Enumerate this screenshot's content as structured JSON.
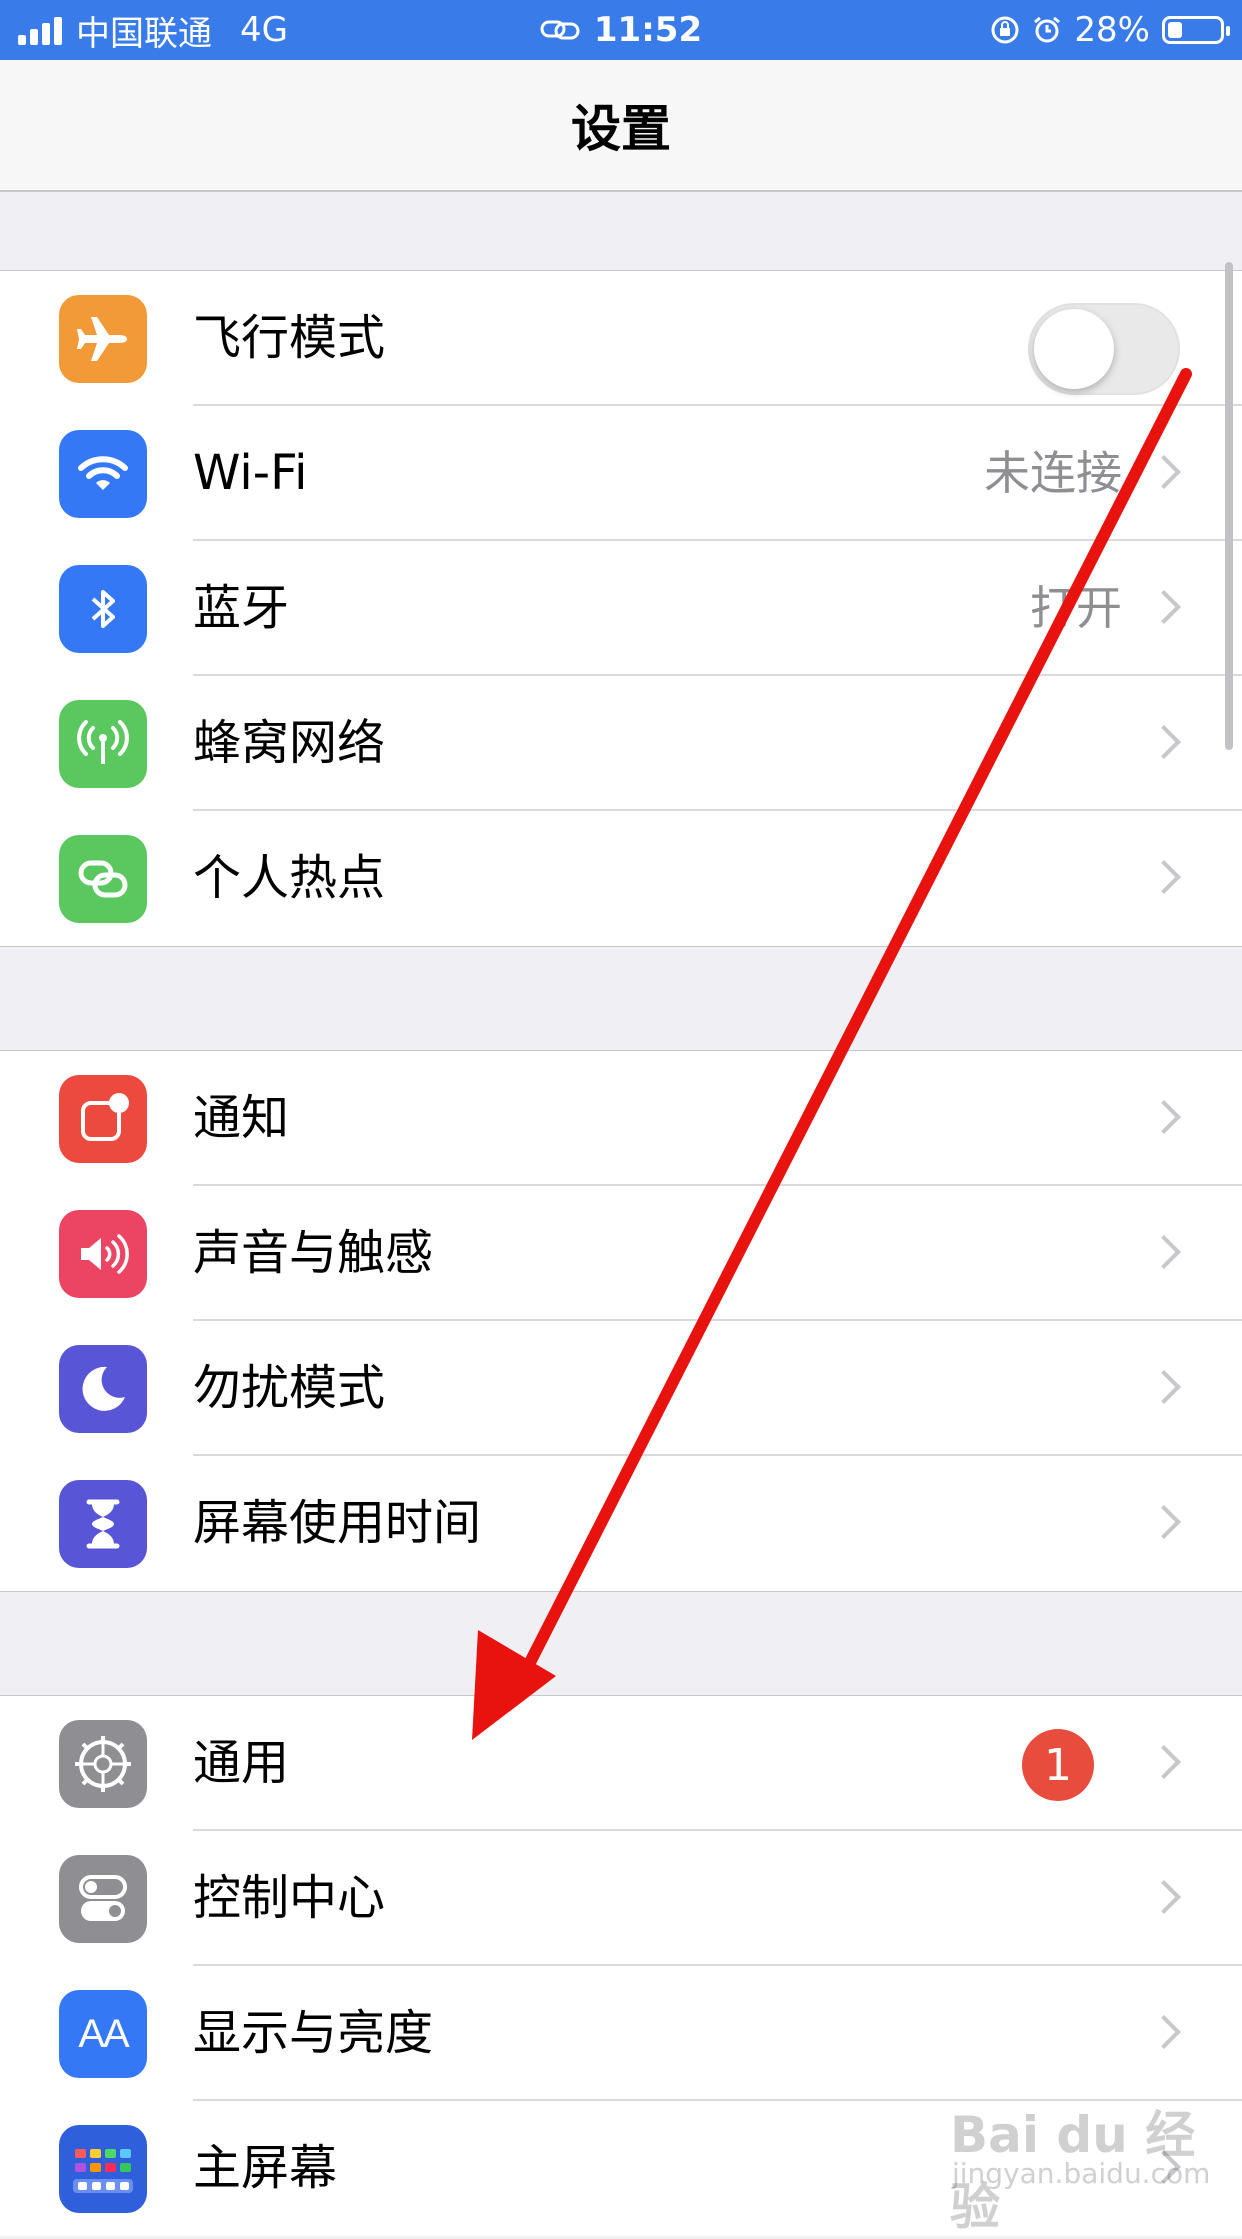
{
  "status_bar": {
    "carrier": "中国联通",
    "network": "4G",
    "time": "11:52",
    "battery": "28%",
    "battery_level": 0.28
  },
  "navbar": {
    "title": "设置"
  },
  "groups": [
    {
      "rows": [
        {
          "label": "飞行模式",
          "icon": "airplane-icon",
          "icon_color": "#f19a37",
          "control": "toggle",
          "toggle_on": false
        },
        {
          "label": "Wi-Fi",
          "icon": "wifi-icon",
          "icon_color": "#3478f6",
          "value": "未连接"
        },
        {
          "label": "蓝牙",
          "icon": "bluetooth-icon",
          "icon_color": "#3478f6",
          "value": "打开"
        },
        {
          "label": "蜂窝网络",
          "icon": "cellular-icon",
          "icon_color": "#5ac85f"
        },
        {
          "label": "个人热点",
          "icon": "hotspot-icon",
          "icon_color": "#5ac85f"
        }
      ]
    },
    {
      "rows": [
        {
          "label": "通知",
          "icon": "notifications-icon",
          "icon_color": "#ec4a3f"
        },
        {
          "label": "声音与触感",
          "icon": "speaker-icon",
          "icon_color": "#ec4563"
        },
        {
          "label": "勿扰模式",
          "icon": "moon-icon",
          "icon_color": "#5856d6"
        },
        {
          "label": "屏幕使用时间",
          "icon": "hourglass-icon",
          "icon_color": "#5856d6"
        }
      ]
    },
    {
      "rows": [
        {
          "label": "通用",
          "icon": "gear-icon",
          "icon_color": "#8e8e93",
          "badge": "1"
        },
        {
          "label": "控制中心",
          "icon": "control-center-icon",
          "icon_color": "#8e8e93"
        },
        {
          "label": "显示与亮度",
          "icon": "display-icon",
          "icon_color": "#3478f6",
          "icon_text": "AA"
        },
        {
          "label": "主屏幕",
          "icon": "home-screen-icon",
          "icon_color": "#2f5fdb"
        }
      ]
    }
  ],
  "annotation": {
    "color": "#e8120e"
  },
  "watermark": {
    "brand": "Bai du 经验",
    "url": "jingyan.baidu.com"
  }
}
